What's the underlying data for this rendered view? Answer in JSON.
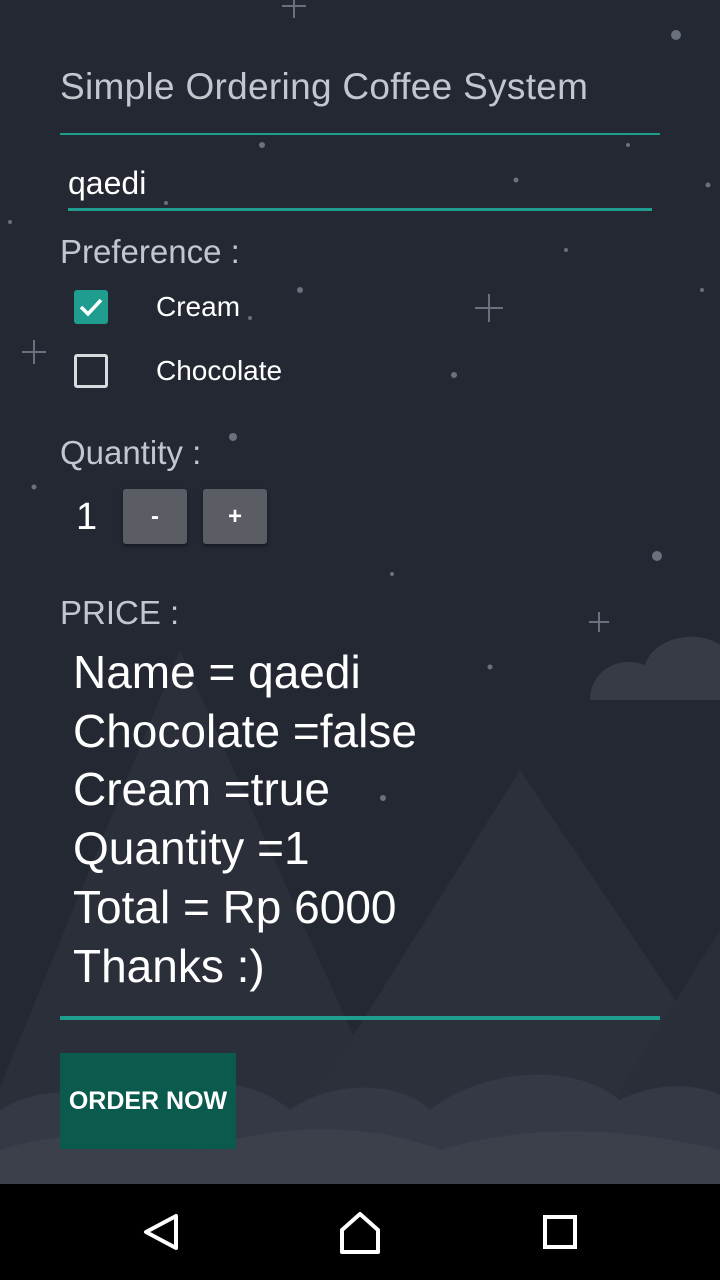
{
  "app": {
    "title": "Simple Ordering Coffee System"
  },
  "form": {
    "name_value": "qaedi",
    "preference_label": "Preference :",
    "preferences": [
      {
        "label": "Cream",
        "checked": true
      },
      {
        "label": "Chocolate",
        "checked": false
      }
    ],
    "quantity_label": "Quantity :",
    "quantity_value": "1",
    "decrement_label": "-",
    "increment_label": "+",
    "price_label": "PRICE :"
  },
  "summary": {
    "lines": [
      "Name = qaedi",
      "Chocolate =false",
      "Cream =true",
      "Quantity =1",
      "Total = Rp 6000",
      "Thanks :)"
    ]
  },
  "actions": {
    "order_label": "ORDER NOW"
  },
  "navbar": {
    "back_icon": "back-triangle-icon",
    "home_icon": "home-icon",
    "recents_icon": "recents-square-icon"
  },
  "colors": {
    "background": "#232833",
    "accent": "#1f9d8e",
    "order_button": "#0a5a4d",
    "qty_button": "#5a5d63"
  }
}
